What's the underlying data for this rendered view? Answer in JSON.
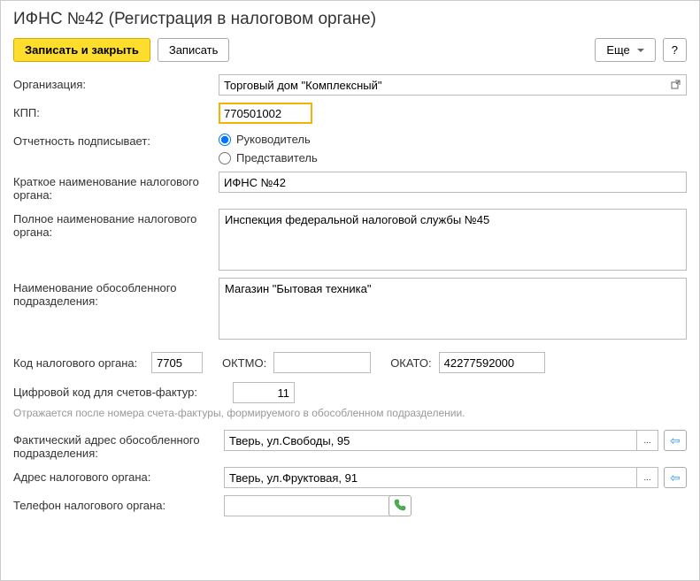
{
  "title": "ИФНС №42 (Регистрация в налоговом органе)",
  "toolbar": {
    "save_close": "Записать и закрыть",
    "save": "Записать",
    "more": "Еще",
    "help": "?"
  },
  "labels": {
    "org": "Организация:",
    "kpp": "КПП:",
    "signer": "Отчетность подписывает:",
    "short_name": "Краткое наименование налогового органа:",
    "full_name": "Полное наименование налогового органа:",
    "division_name": "Наименование обособленного подразделения:",
    "tax_code": "Код налогового органа:",
    "oktmo": "ОКТМО:",
    "okato": "ОКАТО:",
    "digital_code": "Цифровой код для счетов-фактур:",
    "hint": "Отражается после номера счета-фактуры, формируемого в обособленном подразделении.",
    "actual_address": "Фактический адрес обособленного подразделения:",
    "tax_address": "Адрес налогового органа:",
    "phone": "Телефон налогового органа:"
  },
  "values": {
    "org": "Торговый дом \"Комплексный\"",
    "kpp": "770501002",
    "short_name": "ИФНС №42",
    "full_name": "Инспекция федеральной налоговой службы №45",
    "division_name": "Магазин \"Бытовая техника\"",
    "tax_code": "7705",
    "oktmo": "",
    "okato": "42277592000",
    "digital_code": "11",
    "actual_address": "Тверь, ул.Свободы, 95",
    "tax_address": "Тверь, ул.Фруктовая, 91",
    "phone": ""
  },
  "radio": {
    "head": "Руководитель",
    "rep": "Представитель"
  }
}
